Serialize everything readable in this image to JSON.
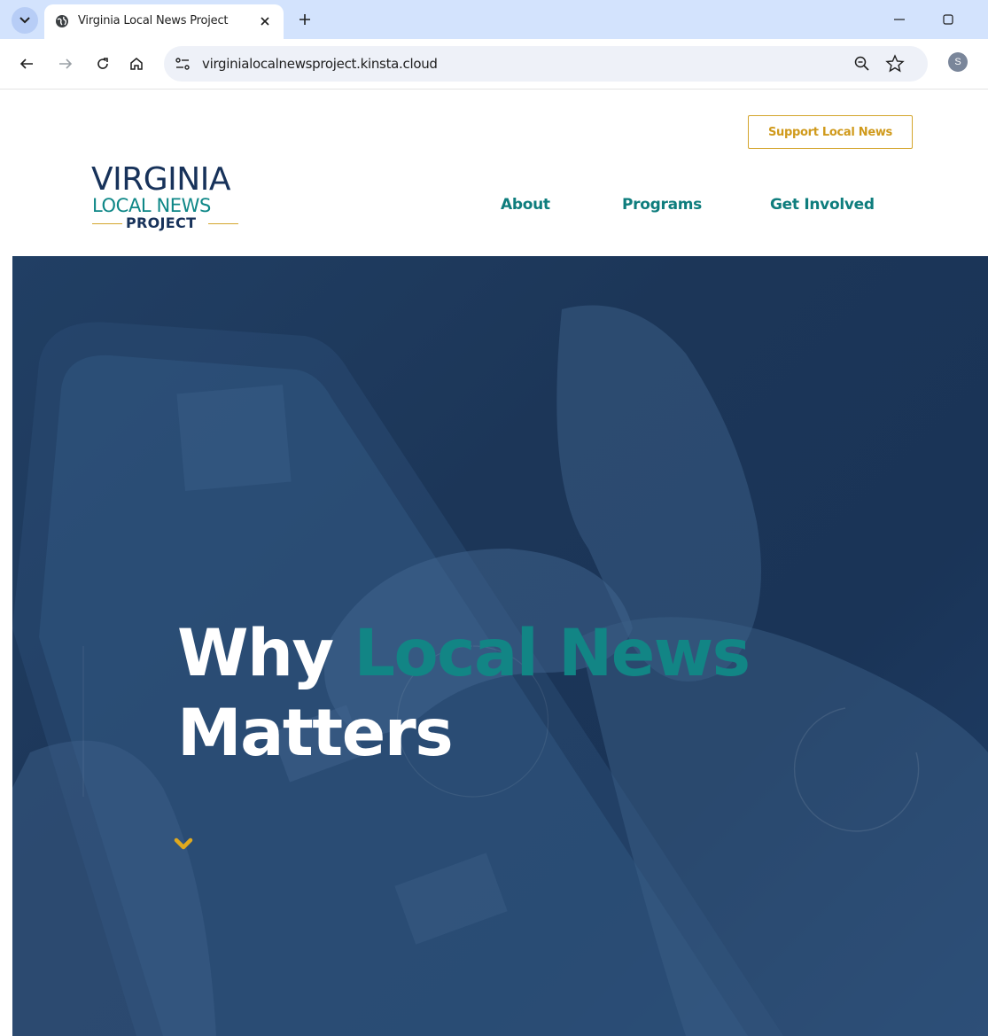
{
  "browser": {
    "tab_title": "Virginia Local News Project",
    "url": "virginialocalnewsproject.kinsta.cloud",
    "profile_initial": "S"
  },
  "header": {
    "support_button": "Support Local News",
    "logo": {
      "line1": "VIRGINIA",
      "line2": "LOCAL NEWS",
      "line3": "PROJECT"
    },
    "nav": [
      "About",
      "Programs",
      "Get Involved"
    ]
  },
  "hero": {
    "title_part1": "Why ",
    "title_accent": "Local News",
    "title_part2": "Matters"
  },
  "colors": {
    "brand_navy": "#17325a",
    "brand_teal": "#0e8787",
    "brand_gold": "#d4a52c",
    "hero_overlay": "#1c3658"
  }
}
